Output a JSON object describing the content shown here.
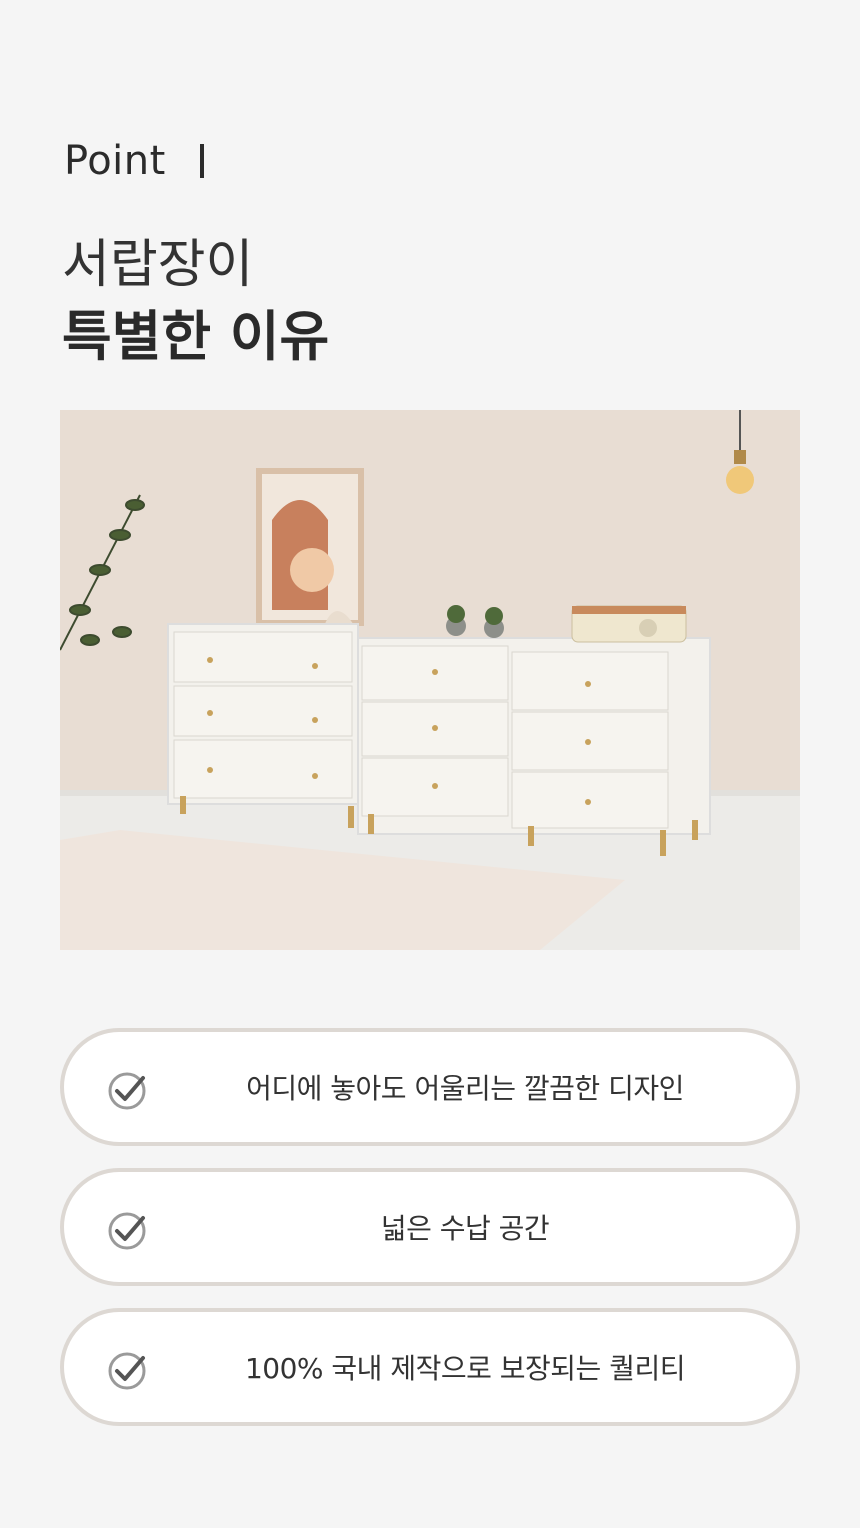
{
  "header": {
    "point_text": "Point",
    "headline_line1": "서랍장이",
    "headline_line2": "특별한 이유"
  },
  "photo": {
    "subject": "white chest of drawers with gold knobs in a living room"
  },
  "features": [
    {
      "icon": "check-circle-icon",
      "text": "어디에 놓아도 어울리는 깔끔한 디자인"
    },
    {
      "icon": "check-circle-icon",
      "text": "넓은 수납 공간"
    },
    {
      "icon": "check-circle-icon",
      "text": "100% 국내 제작으로 보장되는 퀄리티"
    }
  ],
  "colors": {
    "background": "#f5f5f5",
    "card_border": "#ddd8d3",
    "check": "#666666"
  }
}
